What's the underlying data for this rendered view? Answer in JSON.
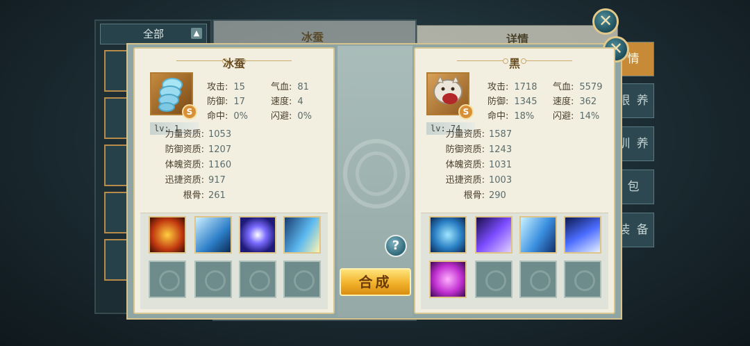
{
  "background": {
    "filter_label": "全部",
    "center_title": "冰蚕",
    "right_header": "详情",
    "side_tabs": [
      "情",
      "眼 养",
      "训 养",
      "包",
      "装 备"
    ]
  },
  "left_pet": {
    "name": "冰蚕",
    "grade": "S",
    "level": "lv: 1",
    "stats": [
      {
        "label": "攻击:",
        "value": "15"
      },
      {
        "label": "气血:",
        "value": "81"
      },
      {
        "label": "防御:",
        "value": "17"
      },
      {
        "label": "速度:",
        "value": "4"
      },
      {
        "label": "命中:",
        "value": "0%"
      },
      {
        "label": "闪避:",
        "value": "0%"
      }
    ],
    "attributes": [
      {
        "label": "力量资质:",
        "value": "1053"
      },
      {
        "label": "防御资质:",
        "value": "1207"
      },
      {
        "label": "体魄资质:",
        "value": "1160"
      },
      {
        "label": "迅捷资质:",
        "value": "917"
      },
      {
        "label": "根骨:",
        "value": "261"
      }
    ],
    "skills": [
      "fire-orb-icon",
      "ice-lightning-icon",
      "arcane-orb-icon",
      "moon-blade-icon"
    ]
  },
  "right_pet": {
    "name": "黑",
    "grade": "S",
    "level": "lv: 74",
    "stats": [
      {
        "label": "攻击:",
        "value": "1718"
      },
      {
        "label": "气血:",
        "value": "5579"
      },
      {
        "label": "防御:",
        "value": "1345"
      },
      {
        "label": "速度:",
        "value": "362"
      },
      {
        "label": "命中:",
        "value": "18%"
      },
      {
        "label": "闪避:",
        "value": "14%"
      }
    ],
    "attributes": [
      {
        "label": "力量资质:",
        "value": "1587"
      },
      {
        "label": "防御资质:",
        "value": "1243"
      },
      {
        "label": "体魄资质:",
        "value": "1031"
      },
      {
        "label": "迅捷资质:",
        "value": "1003"
      },
      {
        "label": "根骨:",
        "value": "290"
      }
    ],
    "skills": [
      "crossed-shield-icon",
      "void-slash-icon",
      "dash-arrows-icon",
      "claw-slash-icon",
      "purple-shield-icon"
    ]
  },
  "actions": {
    "help": "?",
    "compose": "合成",
    "close": "✕"
  }
}
